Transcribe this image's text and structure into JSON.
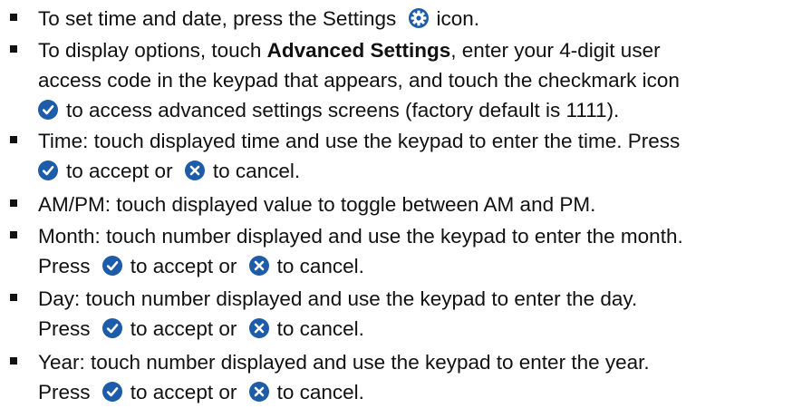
{
  "icons": {
    "settings": "settings-gear-icon",
    "accept": "checkmark-icon",
    "cancel": "cancel-x-icon",
    "color": "#1d5ca8"
  },
  "items": [
    {
      "a": "To set time and date, press the Settings",
      "b": "icon."
    },
    {
      "a": "To display options, touch",
      "bold": "Advanced Settings",
      "b": ", enter your 4-digit user",
      "c": "access code in the keypad that appears, and touch the checkmark icon",
      "d": "to access advanced settings screens (factory default is 1111)."
    },
    {
      "a": "Time: touch displayed time and use the keypad to enter the time. Press",
      "b": "to accept or",
      "c": "to cancel."
    },
    {
      "a": "AM/PM: touch displayed value to toggle between AM and PM."
    },
    {
      "a": "Month: touch number displayed and use the keypad to enter the month.",
      "b": "Press",
      "c": "to accept or",
      "d": "to cancel."
    },
    {
      "a": "Day: touch number displayed and use the keypad to enter the day.",
      "b": "Press",
      "c": "to accept or",
      "d": "to cancel."
    },
    {
      "a": "Year: touch number displayed and use the keypad to enter the year.",
      "b": "Press",
      "c": "to accept or",
      "d": "to cancel."
    }
  ]
}
